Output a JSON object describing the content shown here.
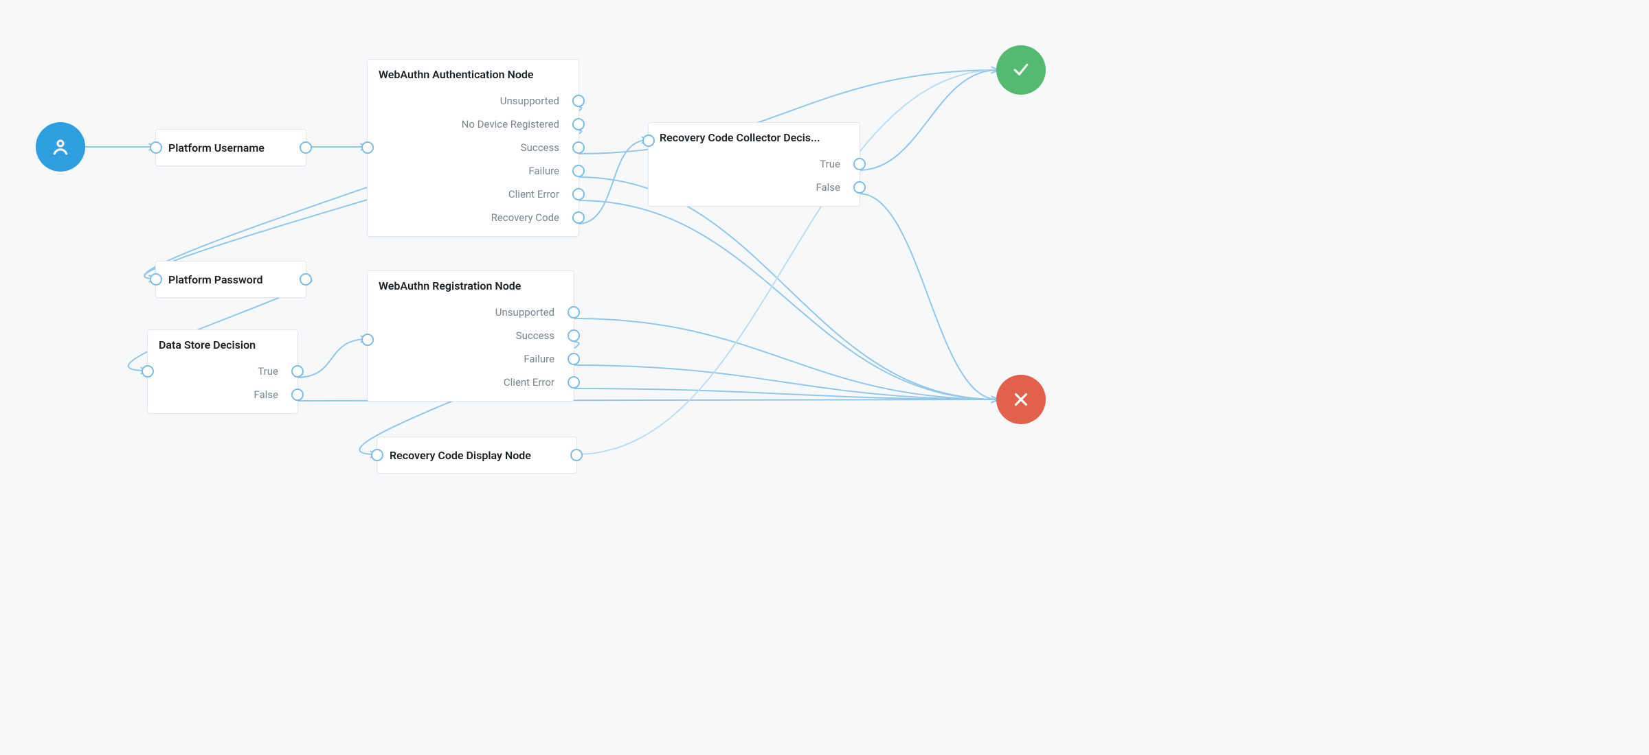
{
  "colors": {
    "background": "#f7f8fa",
    "node_bg": "#ffffff",
    "node_border": "#e2e6ea",
    "port_border": "#7ebce6",
    "wire": "#94c6e8",
    "wire_light": "#bcdcf0",
    "text_title": "#1d2226",
    "text_output": "#7b8690",
    "start_blue": "#2e9ee0",
    "success_green": "#55b971",
    "failure_red": "#e1614e"
  },
  "start": {
    "icon": "user"
  },
  "end_success": {
    "icon": "check"
  },
  "end_failure": {
    "icon": "x"
  },
  "nodes": {
    "platform_username": {
      "title": "Platform Username"
    },
    "platform_password": {
      "title": "Platform Password"
    },
    "data_store_decision": {
      "title": "Data Store Decision",
      "outputs": {
        "true": "True",
        "false": "False"
      }
    },
    "webauthn_auth": {
      "title": "WebAuthn Authentication Node",
      "outputs": {
        "unsupported": "Unsupported",
        "no_device": "No Device Registered",
        "success": "Success",
        "failure": "Failure",
        "client_error": "Client Error",
        "recovery_code": "Recovery Code"
      }
    },
    "webauthn_reg": {
      "title": "WebAuthn Registration Node",
      "outputs": {
        "unsupported": "Unsupported",
        "success": "Success",
        "failure": "Failure",
        "client_error": "Client Error"
      }
    },
    "recovery_display": {
      "title": "Recovery Code Display Node"
    },
    "recovery_collector": {
      "title": "Recovery Code Collector Decis...",
      "outputs": {
        "true": "True",
        "false": "False"
      }
    }
  },
  "connections": [
    {
      "from": "start",
      "to": "platform_username.in"
    },
    {
      "from": "platform_username.out",
      "to": "webauthn_auth.in"
    },
    {
      "from": "webauthn_auth.unsupported",
      "to": "platform_password.in",
      "curve": "down-left"
    },
    {
      "from": "webauthn_auth.no_device",
      "to": "platform_password.in",
      "curve": "down-left"
    },
    {
      "from": "webauthn_auth.success",
      "to": "end_success"
    },
    {
      "from": "webauthn_auth.failure",
      "to": "end_failure"
    },
    {
      "from": "webauthn_auth.client_error",
      "to": "end_failure"
    },
    {
      "from": "webauthn_auth.recovery_code",
      "to": "recovery_collector.in"
    },
    {
      "from": "platform_password.out",
      "to": "data_store_decision.in",
      "curve": "down-left"
    },
    {
      "from": "data_store_decision.true",
      "to": "webauthn_reg.in"
    },
    {
      "from": "data_store_decision.false",
      "to": "end_failure"
    },
    {
      "from": "webauthn_reg.unsupported",
      "to": "end_failure"
    },
    {
      "from": "webauthn_reg.success",
      "to": "recovery_display.in",
      "curve": "down-left"
    },
    {
      "from": "webauthn_reg.failure",
      "to": "end_failure"
    },
    {
      "from": "webauthn_reg.client_error",
      "to": "end_failure"
    },
    {
      "from": "recovery_display.out",
      "to": "end_success",
      "light": true
    },
    {
      "from": "recovery_collector.true",
      "to": "end_success"
    },
    {
      "from": "recovery_collector.false",
      "to": "end_failure"
    }
  ]
}
